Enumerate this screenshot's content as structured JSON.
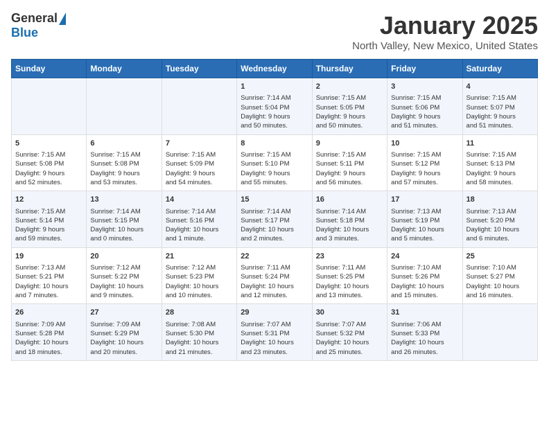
{
  "logo": {
    "general": "General",
    "blue": "Blue"
  },
  "title": "January 2025",
  "location": "North Valley, New Mexico, United States",
  "days_of_week": [
    "Sunday",
    "Monday",
    "Tuesday",
    "Wednesday",
    "Thursday",
    "Friday",
    "Saturday"
  ],
  "weeks": [
    [
      {
        "num": "",
        "info": ""
      },
      {
        "num": "",
        "info": ""
      },
      {
        "num": "",
        "info": ""
      },
      {
        "num": "1",
        "info": "Sunrise: 7:14 AM\nSunset: 5:04 PM\nDaylight: 9 hours\nand 50 minutes."
      },
      {
        "num": "2",
        "info": "Sunrise: 7:15 AM\nSunset: 5:05 PM\nDaylight: 9 hours\nand 50 minutes."
      },
      {
        "num": "3",
        "info": "Sunrise: 7:15 AM\nSunset: 5:06 PM\nDaylight: 9 hours\nand 51 minutes."
      },
      {
        "num": "4",
        "info": "Sunrise: 7:15 AM\nSunset: 5:07 PM\nDaylight: 9 hours\nand 51 minutes."
      }
    ],
    [
      {
        "num": "5",
        "info": "Sunrise: 7:15 AM\nSunset: 5:08 PM\nDaylight: 9 hours\nand 52 minutes."
      },
      {
        "num": "6",
        "info": "Sunrise: 7:15 AM\nSunset: 5:08 PM\nDaylight: 9 hours\nand 53 minutes."
      },
      {
        "num": "7",
        "info": "Sunrise: 7:15 AM\nSunset: 5:09 PM\nDaylight: 9 hours\nand 54 minutes."
      },
      {
        "num": "8",
        "info": "Sunrise: 7:15 AM\nSunset: 5:10 PM\nDaylight: 9 hours\nand 55 minutes."
      },
      {
        "num": "9",
        "info": "Sunrise: 7:15 AM\nSunset: 5:11 PM\nDaylight: 9 hours\nand 56 minutes."
      },
      {
        "num": "10",
        "info": "Sunrise: 7:15 AM\nSunset: 5:12 PM\nDaylight: 9 hours\nand 57 minutes."
      },
      {
        "num": "11",
        "info": "Sunrise: 7:15 AM\nSunset: 5:13 PM\nDaylight: 9 hours\nand 58 minutes."
      }
    ],
    [
      {
        "num": "12",
        "info": "Sunrise: 7:15 AM\nSunset: 5:14 PM\nDaylight: 9 hours\nand 59 minutes."
      },
      {
        "num": "13",
        "info": "Sunrise: 7:14 AM\nSunset: 5:15 PM\nDaylight: 10 hours\nand 0 minutes."
      },
      {
        "num": "14",
        "info": "Sunrise: 7:14 AM\nSunset: 5:16 PM\nDaylight: 10 hours\nand 1 minute."
      },
      {
        "num": "15",
        "info": "Sunrise: 7:14 AM\nSunset: 5:17 PM\nDaylight: 10 hours\nand 2 minutes."
      },
      {
        "num": "16",
        "info": "Sunrise: 7:14 AM\nSunset: 5:18 PM\nDaylight: 10 hours\nand 3 minutes."
      },
      {
        "num": "17",
        "info": "Sunrise: 7:13 AM\nSunset: 5:19 PM\nDaylight: 10 hours\nand 5 minutes."
      },
      {
        "num": "18",
        "info": "Sunrise: 7:13 AM\nSunset: 5:20 PM\nDaylight: 10 hours\nand 6 minutes."
      }
    ],
    [
      {
        "num": "19",
        "info": "Sunrise: 7:13 AM\nSunset: 5:21 PM\nDaylight: 10 hours\nand 7 minutes."
      },
      {
        "num": "20",
        "info": "Sunrise: 7:12 AM\nSunset: 5:22 PM\nDaylight: 10 hours\nand 9 minutes."
      },
      {
        "num": "21",
        "info": "Sunrise: 7:12 AM\nSunset: 5:23 PM\nDaylight: 10 hours\nand 10 minutes."
      },
      {
        "num": "22",
        "info": "Sunrise: 7:11 AM\nSunset: 5:24 PM\nDaylight: 10 hours\nand 12 minutes."
      },
      {
        "num": "23",
        "info": "Sunrise: 7:11 AM\nSunset: 5:25 PM\nDaylight: 10 hours\nand 13 minutes."
      },
      {
        "num": "24",
        "info": "Sunrise: 7:10 AM\nSunset: 5:26 PM\nDaylight: 10 hours\nand 15 minutes."
      },
      {
        "num": "25",
        "info": "Sunrise: 7:10 AM\nSunset: 5:27 PM\nDaylight: 10 hours\nand 16 minutes."
      }
    ],
    [
      {
        "num": "26",
        "info": "Sunrise: 7:09 AM\nSunset: 5:28 PM\nDaylight: 10 hours\nand 18 minutes."
      },
      {
        "num": "27",
        "info": "Sunrise: 7:09 AM\nSunset: 5:29 PM\nDaylight: 10 hours\nand 20 minutes."
      },
      {
        "num": "28",
        "info": "Sunrise: 7:08 AM\nSunset: 5:30 PM\nDaylight: 10 hours\nand 21 minutes."
      },
      {
        "num": "29",
        "info": "Sunrise: 7:07 AM\nSunset: 5:31 PM\nDaylight: 10 hours\nand 23 minutes."
      },
      {
        "num": "30",
        "info": "Sunrise: 7:07 AM\nSunset: 5:32 PM\nDaylight: 10 hours\nand 25 minutes."
      },
      {
        "num": "31",
        "info": "Sunrise: 7:06 AM\nSunset: 5:33 PM\nDaylight: 10 hours\nand 26 minutes."
      },
      {
        "num": "",
        "info": ""
      }
    ]
  ]
}
